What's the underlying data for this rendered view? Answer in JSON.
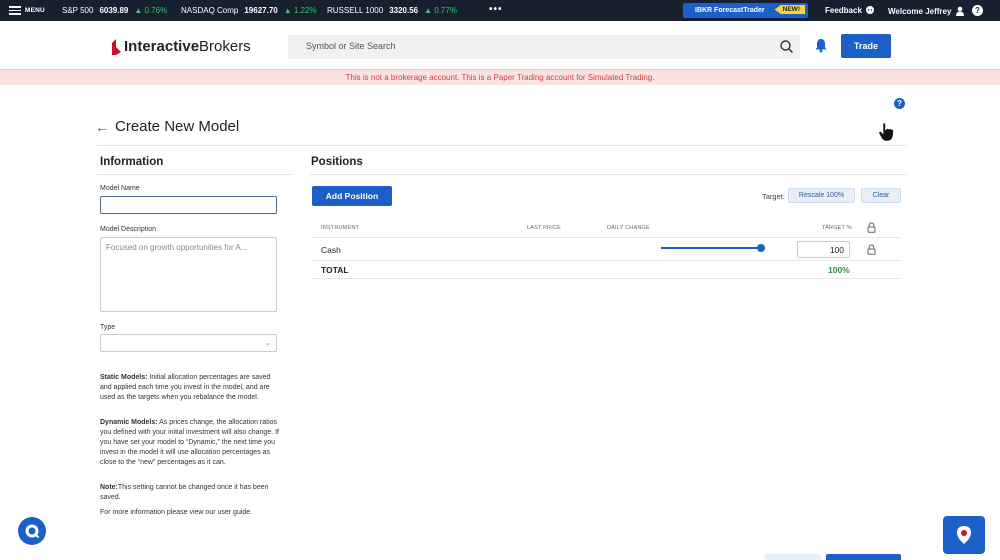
{
  "topbar": {
    "menu_label": "MENU",
    "tickers": [
      {
        "name": "S&P 500",
        "value": "6039.89",
        "change": "▲ 0.76%"
      },
      {
        "name": "NASDAQ Comp",
        "value": "19627.70",
        "change": "▲ 1.22%"
      },
      {
        "name": "RUSSELL 1000",
        "value": "3320.56",
        "change": "▲ 0.77%"
      }
    ],
    "more": "•••",
    "forecast_label": "IBKR ForecastTrader",
    "forecast_badge": "NEW!",
    "feedback_label": "Feedback",
    "welcome_label": "Welcome Jeffrey",
    "help": "?"
  },
  "header": {
    "logo_bold": "Interactive",
    "logo_rest": "Brokers",
    "search_placeholder": "Symbol or Site Search",
    "trade_label": "Trade"
  },
  "banner": "This is not a brokerage account. This is a Paper Trading account for Simulated Trading.",
  "page": {
    "back": "←",
    "title": "Create New Model",
    "help": "?"
  },
  "information": {
    "heading": "Information",
    "model_name_label": "Model Name",
    "model_name_value": "",
    "description_label": "Model Description",
    "description_value": "Focused on growth opportunities for A...",
    "type_label": "Type",
    "type_value": "",
    "static_title": "Static Models:",
    "static_text": " Initial allocation percentages are saved and applied each time you invest in the model, and are used as the targets when you rebalance the model.",
    "dynamic_title": "Dynamic Models:",
    "dynamic_text": " As prices change, the allocation ratios you defined with your initial investment will also change. If you have set your model to “Dynamic,” the next time you invest in the model it will use allocation percentages as close to the “new” percentages as it can.",
    "note_title": "Note:",
    "note_text": "This setting cannot be changed once it has been saved.",
    "more_info": "For more information please view our user guide."
  },
  "positions": {
    "heading": "Positions",
    "add_label": "Add Position",
    "target_label": "Target:",
    "rescale_label": "Rescale 100%",
    "clear_label": "Clear",
    "columns": {
      "instrument": "INSTRUMENT",
      "last_price": "LAST PRICE",
      "daily_change": "DAILY CHANGE",
      "target": "TARGET %"
    },
    "rows": [
      {
        "instrument": "Cash",
        "target": "100",
        "slider_fraction": 1.0
      }
    ],
    "total_label": "TOTAL",
    "total_value": "100%"
  },
  "colors": {
    "accent": "#1d5fc9",
    "positive": "#2e8a45",
    "banner_text": "#d04040"
  },
  "icons": [
    "hamburger-icon",
    "feedback-icon",
    "user-icon",
    "search-icon",
    "bell-icon",
    "lock-icon",
    "chat-icon",
    "hand-cursor-icon"
  ]
}
